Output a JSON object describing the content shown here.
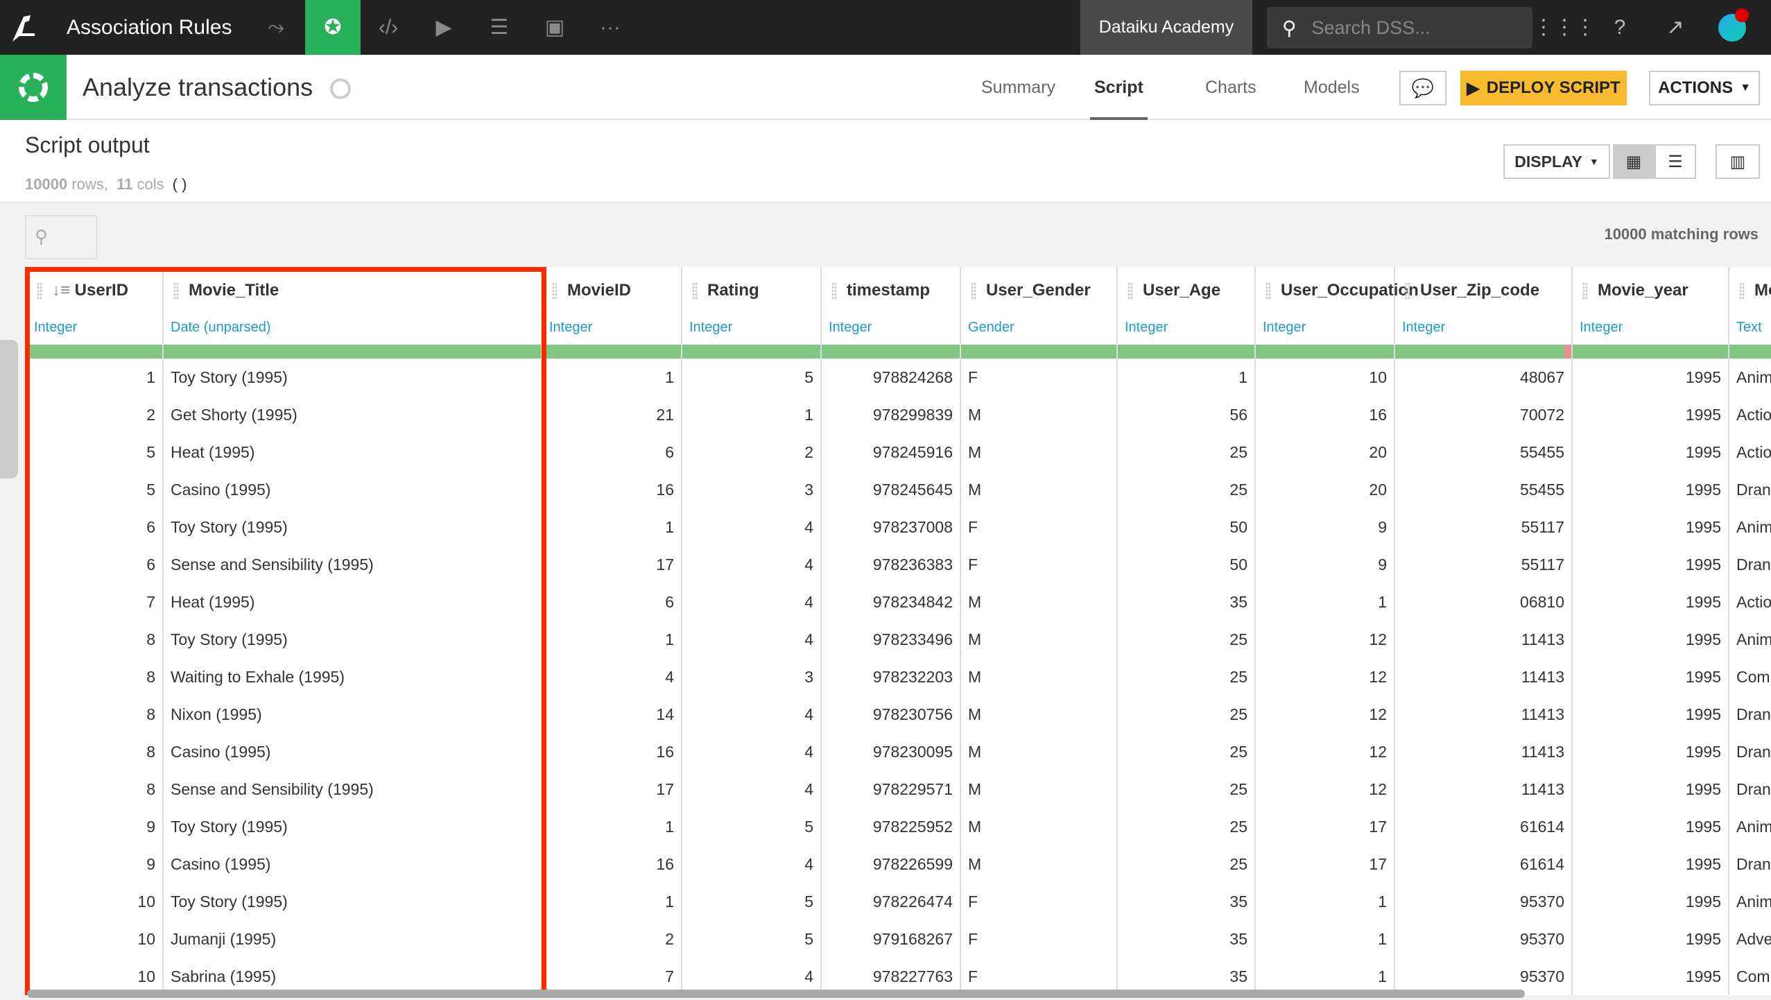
{
  "topbar": {
    "app_title": "Association Rules",
    "academy": "Dataiku Academy",
    "search_placeholder": "Search DSS...",
    "nav_icons": [
      "flow-icon",
      "recipe-icon",
      "code-icon",
      "run-icon",
      "datasets-icon",
      "dashboard-icon",
      "more-icon"
    ]
  },
  "recipe": {
    "title": "Analyze transactions",
    "tabs": [
      {
        "label": "Summary"
      },
      {
        "label": "Script"
      },
      {
        "label": "Charts"
      },
      {
        "label": "Models"
      }
    ],
    "active_tab": "Script",
    "deploy_label": "DEPLOY SCRIPT",
    "actions_label": "ACTIONS"
  },
  "output": {
    "title": "Script output",
    "rows": "10000",
    "rows_label": "rows,",
    "cols": "11",
    "cols_label": "cols",
    "paren": "( )",
    "display_label": "DISPLAY",
    "matching": "10000 matching rows"
  },
  "columns": [
    {
      "name": "UserID",
      "type": "Integer",
      "align": "num"
    },
    {
      "name": "Movie_Title",
      "type": "Date (unparsed)",
      "align": "text"
    },
    {
      "name": "MovieID",
      "type": "Integer",
      "align": "num"
    },
    {
      "name": "Rating",
      "type": "Integer",
      "align": "num"
    },
    {
      "name": "timestamp",
      "type": "Integer",
      "align": "num"
    },
    {
      "name": "User_Gender",
      "type": "Gender",
      "align": "text"
    },
    {
      "name": "User_Age",
      "type": "Integer",
      "align": "num"
    },
    {
      "name": "User_Occupation",
      "type": "Integer",
      "align": "num"
    },
    {
      "name": "User_Zip_code",
      "type": "Integer",
      "align": "num"
    },
    {
      "name": "Movie_year",
      "type": "Integer",
      "align": "num"
    },
    {
      "name": "Mo",
      "type": "Text",
      "align": "text"
    }
  ],
  "rows": [
    [
      "1",
      "Toy Story (1995)",
      "1",
      "5",
      "978824268",
      "F",
      "1",
      "10",
      "48067",
      "1995",
      "Anim"
    ],
    [
      "2",
      "Get Shorty (1995)",
      "21",
      "1",
      "978299839",
      "M",
      "56",
      "16",
      "70072",
      "1995",
      "Actio"
    ],
    [
      "5",
      "Heat (1995)",
      "6",
      "2",
      "978245916",
      "M",
      "25",
      "20",
      "55455",
      "1995",
      "Actio"
    ],
    [
      "5",
      "Casino (1995)",
      "16",
      "3",
      "978245645",
      "M",
      "25",
      "20",
      "55455",
      "1995",
      "Dran"
    ],
    [
      "6",
      "Toy Story (1995)",
      "1",
      "4",
      "978237008",
      "F",
      "50",
      "9",
      "55117",
      "1995",
      "Anim"
    ],
    [
      "6",
      "Sense and Sensibility (1995)",
      "17",
      "4",
      "978236383",
      "F",
      "50",
      "9",
      "55117",
      "1995",
      "Dran"
    ],
    [
      "7",
      "Heat (1995)",
      "6",
      "4",
      "978234842",
      "M",
      "35",
      "1",
      "06810",
      "1995",
      "Actio"
    ],
    [
      "8",
      "Toy Story (1995)",
      "1",
      "4",
      "978233496",
      "M",
      "25",
      "12",
      "11413",
      "1995",
      "Anim"
    ],
    [
      "8",
      "Waiting to Exhale (1995)",
      "4",
      "3",
      "978232203",
      "M",
      "25",
      "12",
      "11413",
      "1995",
      "Com"
    ],
    [
      "8",
      "Nixon (1995)",
      "14",
      "4",
      "978230756",
      "M",
      "25",
      "12",
      "11413",
      "1995",
      "Dran"
    ],
    [
      "8",
      "Casino (1995)",
      "16",
      "4",
      "978230095",
      "M",
      "25",
      "12",
      "11413",
      "1995",
      "Dran"
    ],
    [
      "8",
      "Sense and Sensibility (1995)",
      "17",
      "4",
      "978229571",
      "M",
      "25",
      "12",
      "11413",
      "1995",
      "Dran"
    ],
    [
      "9",
      "Toy Story (1995)",
      "1",
      "5",
      "978225952",
      "M",
      "25",
      "17",
      "61614",
      "1995",
      "Anim"
    ],
    [
      "9",
      "Casino (1995)",
      "16",
      "4",
      "978226599",
      "M",
      "25",
      "17",
      "61614",
      "1995",
      "Dran"
    ],
    [
      "10",
      "Toy Story (1995)",
      "1",
      "5",
      "978226474",
      "F",
      "35",
      "1",
      "95370",
      "1995",
      "Anim"
    ],
    [
      "10",
      "Jumanji (1995)",
      "2",
      "5",
      "979168267",
      "F",
      "35",
      "1",
      "95370",
      "1995",
      "Adve"
    ],
    [
      "10",
      "Sabrina (1995)",
      "7",
      "4",
      "978227763",
      "F",
      "35",
      "1",
      "95370",
      "1995",
      "Com"
    ]
  ],
  "colors": {
    "accent": "#28b05b",
    "deploy": "#f8bb30",
    "highlight": "#ff2a00",
    "type_link": "#1a9bd7",
    "quality_ok": "#80c784"
  }
}
